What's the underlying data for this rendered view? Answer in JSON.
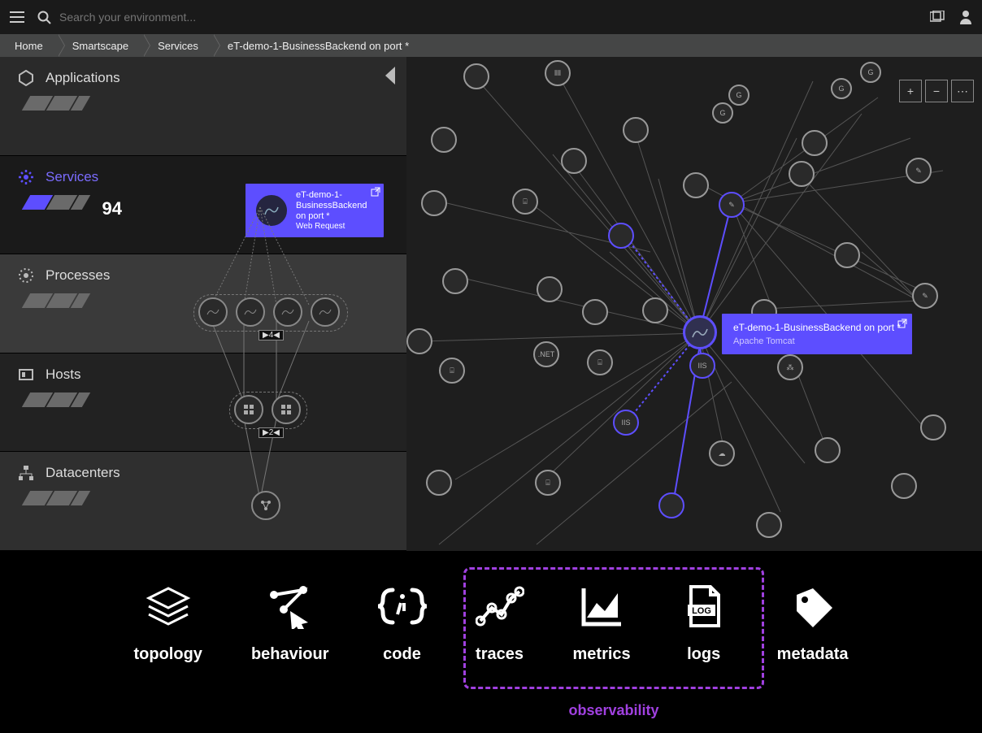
{
  "topbar": {
    "search_placeholder": "Search your environment..."
  },
  "breadcrumbs": [
    "Home",
    "Smartscape",
    "Services",
    "eT-demo-1-BusinessBackend on port *"
  ],
  "layers": {
    "applications": {
      "label": "Applications"
    },
    "services": {
      "label": "Services",
      "count": "94"
    },
    "processes": {
      "label": "Processes",
      "badge": "▶4◀"
    },
    "hosts": {
      "label": "Hosts",
      "badge": "▶2◀"
    },
    "datacenters": {
      "label": "Datacenters"
    }
  },
  "svc_tooltip": {
    "line1": "eT-demo-1-BusinessBackend on port *",
    "line2": "Web Request"
  },
  "graph_tooltip": {
    "title": "eT-demo-1-BusinessBackend on port *",
    "subtitle": "Apache Tomcat"
  },
  "graph_labels": {
    "dotnet": ".NET",
    "iis1": "IIS",
    "iis2": "IIS"
  },
  "map_controls": {
    "zoom_in": "+",
    "zoom_out": "−",
    "more": "⋯"
  },
  "dock": {
    "topology": "topology",
    "behaviour": "behaviour",
    "code": "code",
    "traces": "traces",
    "metrics": "metrics",
    "logs": "logs",
    "metadata": "metadata"
  },
  "observability_label": "observability"
}
